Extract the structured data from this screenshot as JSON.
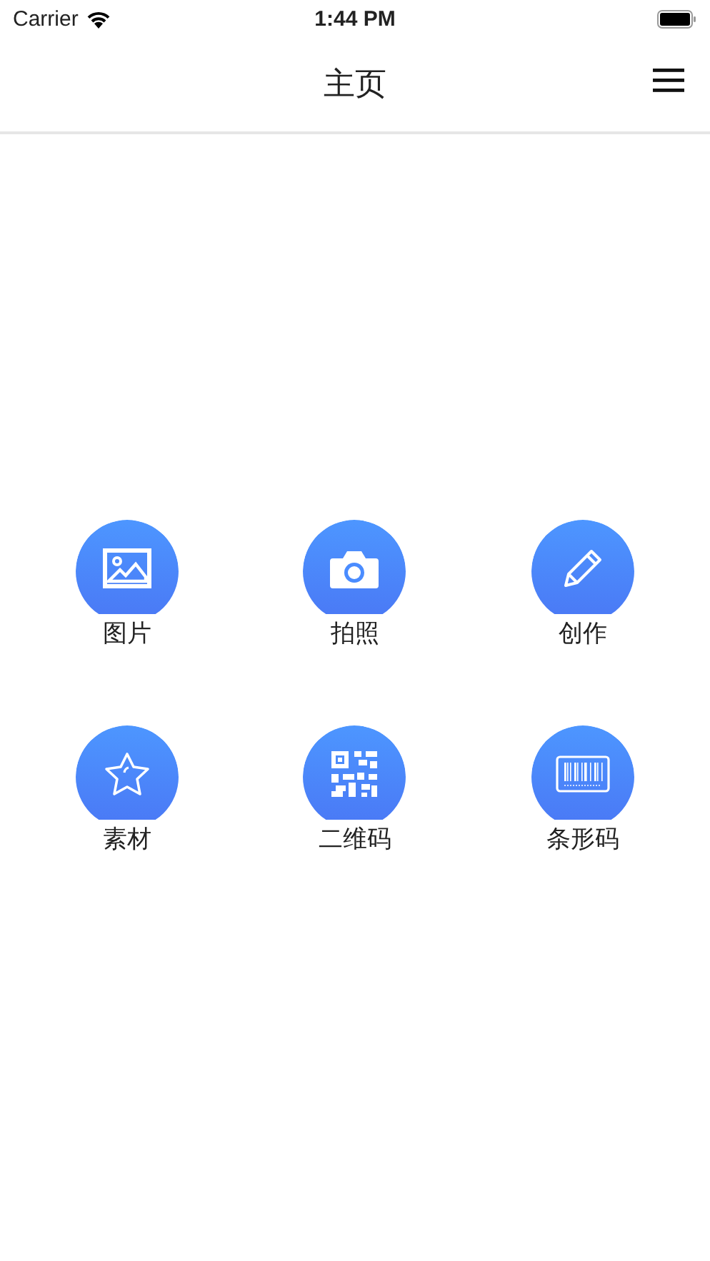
{
  "status_bar": {
    "carrier": "Carrier",
    "time": "1:44 PM"
  },
  "nav": {
    "title": "主页"
  },
  "tiles": [
    {
      "label": "图片",
      "kind": "image"
    },
    {
      "label": "拍照",
      "kind": "camera"
    },
    {
      "label": "创作",
      "kind": "pencil"
    },
    {
      "label": "素材",
      "kind": "star"
    },
    {
      "label": "二维码",
      "kind": "qrcode"
    },
    {
      "label": "条形码",
      "kind": "barcode"
    }
  ]
}
